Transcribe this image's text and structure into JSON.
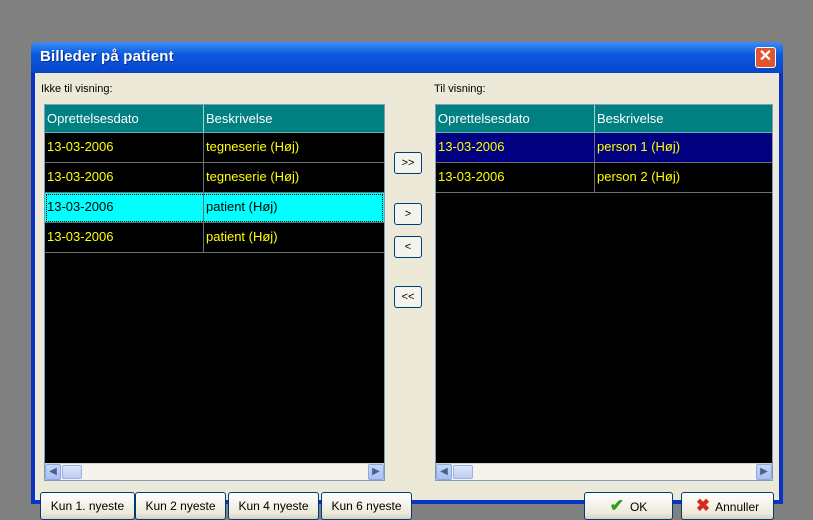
{
  "window": {
    "title": "Billeder på patient",
    "close_symbol": "✕"
  },
  "left_panel": {
    "label": "Ikke til visning:",
    "columns": [
      "Oprettelsesdato",
      "Beskrivelse"
    ],
    "rows": [
      {
        "date": "13-03-2006",
        "description": "tegneserie (Høj)"
      },
      {
        "date": "13-03-2006",
        "description": "tegneserie (Høj)"
      },
      {
        "date": "13-03-2006",
        "description": "patient (Høj)"
      },
      {
        "date": "13-03-2006",
        "description": "patient (Høj)"
      }
    ]
  },
  "right_panel": {
    "label": "Til visning:",
    "columns": [
      "Oprettelsesdato",
      "Beskrivelse"
    ],
    "rows": [
      {
        "date": "13-03-2006",
        "description": "person 1 (Høj)"
      },
      {
        "date": "13-03-2006",
        "description": "person 2 (Høj)"
      }
    ]
  },
  "move_buttons": {
    "move_all_right": ">>",
    "move_right": ">",
    "move_left": "<",
    "move_all_left": "<<"
  },
  "filter_buttons": [
    "Kun 1. nyeste",
    "Kun 2 nyeste",
    "Kun 4 nyeste",
    "Kun 6 nyeste"
  ],
  "dialog_buttons": {
    "ok": "OK",
    "cancel": "Annuller"
  },
  "scroll_symbols": {
    "left": "◀",
    "right": "▶"
  },
  "colors": {
    "header_bg": "#008080",
    "row_text": "#ffff00",
    "selected_row_bg": "#00ffff",
    "selected_row_right_bg": "#000080",
    "grid_bg": "#000000"
  }
}
